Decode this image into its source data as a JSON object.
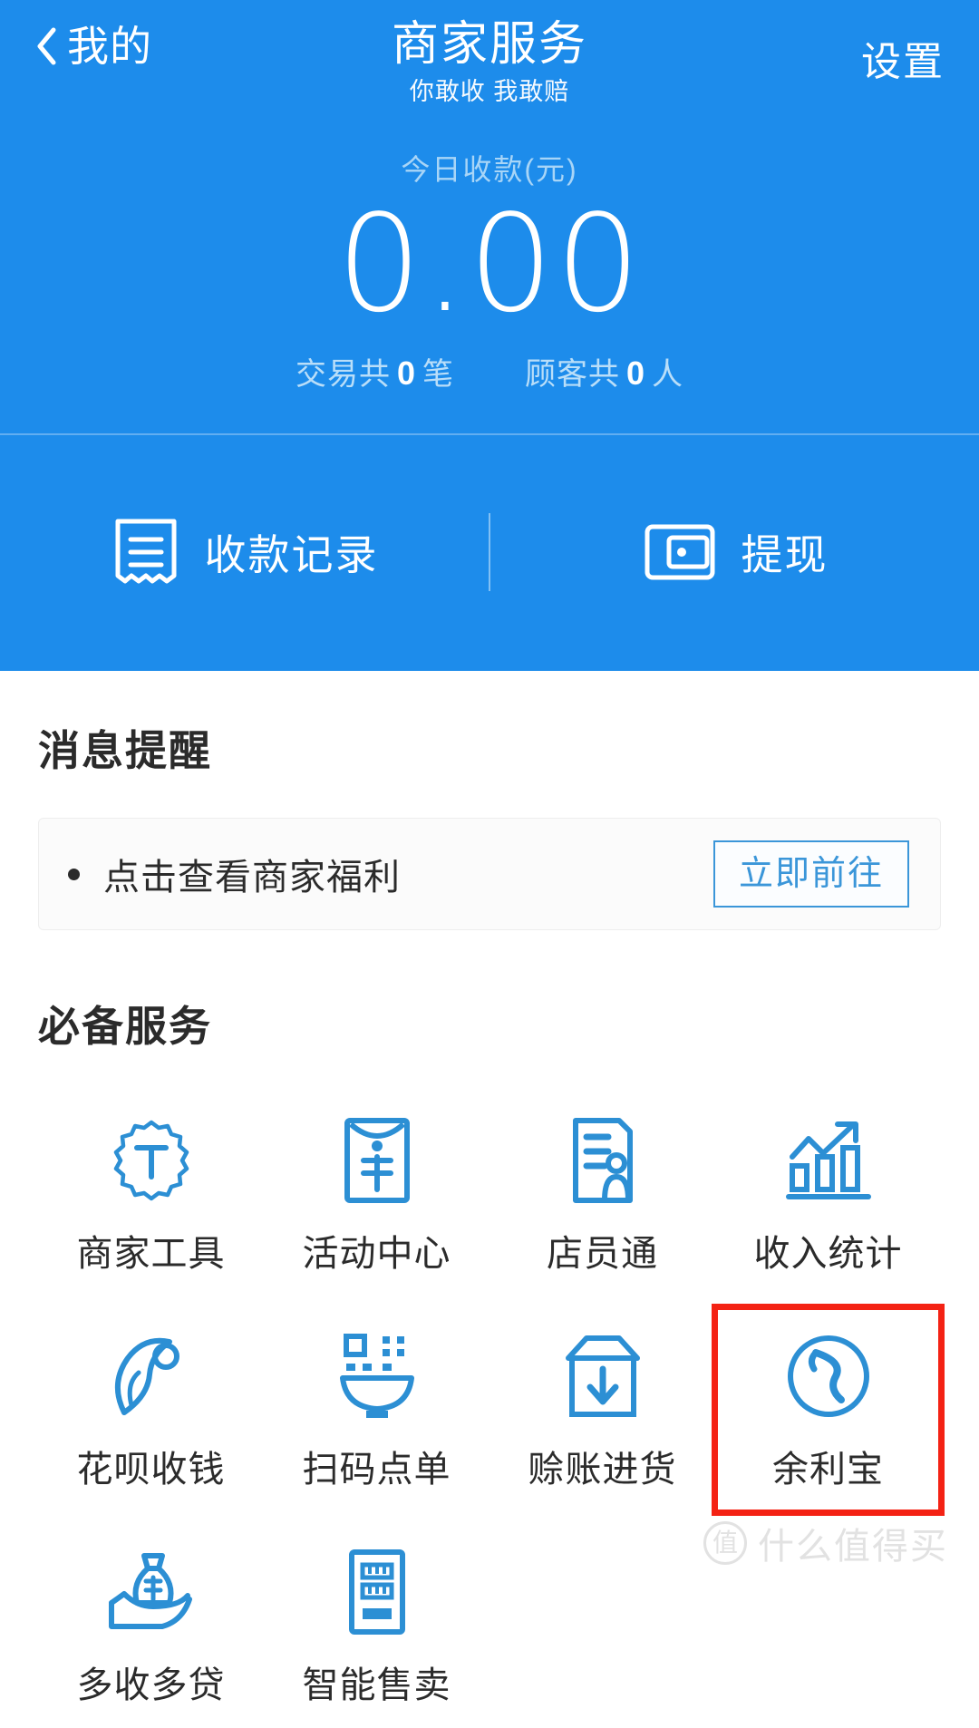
{
  "colors": {
    "brand_blue": "#1d8ceb",
    "icon_blue": "#2c8fd4",
    "highlight_red": "#f42214",
    "muted_blue_text": "#a8d5f7"
  },
  "header": {
    "back_label": "我的",
    "title": "商家服务",
    "subtitle": "你敢收 我敢赔",
    "settings_label": "设置"
  },
  "summary": {
    "label": "今日收款(元)",
    "amount": "0.00",
    "stats": [
      {
        "prefix": "交易共",
        "value": "0",
        "suffix": "笔"
      },
      {
        "prefix": "顾客共",
        "value": "0",
        "suffix": "人"
      }
    ]
  },
  "actions": [
    {
      "label": "收款记录",
      "icon": "receipt-icon"
    },
    {
      "label": "提现",
      "icon": "wallet-icon"
    }
  ],
  "notice": {
    "section_title": "消息提醒",
    "item_text": "点击查看商家福利",
    "button_label": "立即前往"
  },
  "services": {
    "section_title": "必备服务",
    "items": [
      {
        "label": "商家工具",
        "icon": "badge-t-icon",
        "highlighted": false
      },
      {
        "label": "活动中心",
        "icon": "red-envelope-yuan-icon",
        "highlighted": false
      },
      {
        "label": "店员通",
        "icon": "document-person-icon",
        "highlighted": false
      },
      {
        "label": "收入统计",
        "icon": "bar-chart-arrow-icon",
        "highlighted": false
      },
      {
        "label": "花呗收钱",
        "icon": "huabei-icon",
        "highlighted": false
      },
      {
        "label": "扫码点单",
        "icon": "qr-bowl-icon",
        "highlighted": false
      },
      {
        "label": "赊账进货",
        "icon": "box-download-icon",
        "highlighted": false
      },
      {
        "label": "余利宝",
        "icon": "yulibao-swoosh-icon",
        "highlighted": true
      },
      {
        "label": "多收多贷",
        "icon": "hand-money-bag-icon",
        "highlighted": false
      },
      {
        "label": "智能售卖",
        "icon": "vending-machine-icon",
        "highlighted": false
      }
    ]
  },
  "watermark": {
    "logo_char": "值",
    "text": "什么值得买"
  }
}
